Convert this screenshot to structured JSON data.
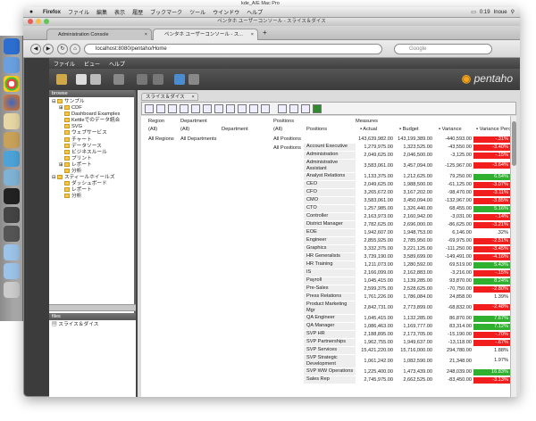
{
  "mac_menu": {
    "apple": "",
    "items": [
      "Firefox",
      "ファイル",
      "編集",
      "表示",
      "履歴",
      "ブックマーク",
      "ツール",
      "ウインドウ",
      "ヘルプ"
    ],
    "battery": "0:19",
    "user": "Inoue"
  },
  "screen_title": "kde_A/E Mac Pro",
  "window_title": "ペンタホ ユーザーコンソール - スライス＆ダイス",
  "tabs": [
    {
      "label": "Administration Console"
    },
    {
      "label": "ペンタホ ユーザーコンソール - ス..."
    }
  ],
  "new_tab": "+",
  "url": "localhost:8080/pentaho/Home",
  "search_placeholder": "Google",
  "app_menu": [
    "ファイル",
    "ビュー",
    "ヘルプ"
  ],
  "logo": {
    "mark": "◉",
    "text": "pentaho",
    "brand_color": "#f7a31a"
  },
  "browse": {
    "title": "browse",
    "tree": [
      {
        "label": "サンプル",
        "level": 0,
        "toggle": "⊟"
      },
      {
        "label": "CDF",
        "level": 1,
        "toggle": "⊞"
      },
      {
        "label": "Dashboard Examples",
        "level": 1,
        "toggle": ""
      },
      {
        "label": "Kettleでのデータ統合",
        "level": 1,
        "toggle": ""
      },
      {
        "label": "SVG",
        "level": 1,
        "toggle": ""
      },
      {
        "label": "ウェブサービス",
        "level": 1,
        "toggle": ""
      },
      {
        "label": "チャート",
        "level": 1,
        "toggle": ""
      },
      {
        "label": "データソース",
        "level": 1,
        "toggle": ""
      },
      {
        "label": "ビジネスルール",
        "level": 1,
        "toggle": ""
      },
      {
        "label": "プリント",
        "level": 1,
        "toggle": ""
      },
      {
        "label": "レポート",
        "level": 1,
        "toggle": "⊞"
      },
      {
        "label": "分析",
        "level": 1,
        "toggle": ""
      },
      {
        "label": "スティールホイールズ",
        "level": 0,
        "toggle": "⊟"
      },
      {
        "label": "ダッシュボード",
        "level": 1,
        "toggle": ""
      },
      {
        "label": "レポート",
        "level": 1,
        "toggle": ""
      },
      {
        "label": "分析",
        "level": 1,
        "toggle": ""
      }
    ]
  },
  "files": {
    "title": "files",
    "items": [
      "スライス＆ダイス"
    ]
  },
  "doc_tab": {
    "label": "スライス＆ダイス",
    "close": "×"
  },
  "pivot": {
    "h_region": "Region",
    "h_department": "Department",
    "h_positions": "Positions",
    "h_measures": "Measures",
    "all_region": "(All)",
    "all_department": "(All)",
    "department_col": "Department",
    "all_positions": "(All)",
    "positions_col": "Positions",
    "all_regions_label": "All Regions",
    "all_departments_label": "All Departments",
    "all_positions_label": "All Positions",
    "all_positions_label2": "All Positions",
    "cols": [
      "Actual",
      "Budget",
      "Variance",
      "Variance Percent"
    ],
    "rows": [
      {
        "name": "",
        "actual": "143,639,982.00",
        "budget": "143,199,389.00",
        "variance": "-440,593.00",
        "vp": "-.31%",
        "color": "red"
      },
      {
        "name": "Account Executive",
        "actual": "1,279,975.00",
        "budget": "1,323,525.00",
        "variance": "-43,550.00",
        "vp": "-3.40%",
        "color": "red"
      },
      {
        "name": "Administration",
        "actual": "2,049,625.00",
        "budget": "2,046,500.00",
        "variance": "-3,125.00",
        "vp": "-.15%",
        "color": "red"
      },
      {
        "name": "Administrative Assistant",
        "actual": "3,583,061.00",
        "budget": "3,457,094.00",
        "variance": "-125,967.00",
        "vp": "-3.64%",
        "color": "red"
      },
      {
        "name": "Analyst Relations",
        "actual": "1,133,375.00",
        "budget": "1,212,625.00",
        "variance": "79,250.00",
        "vp": "6.54%",
        "color": "green"
      },
      {
        "name": "CEO",
        "actual": "2,049,625.00",
        "budget": "1,988,500.00",
        "variance": "-61,125.00",
        "vp": "-3.07%",
        "color": "red"
      },
      {
        "name": "CFO",
        "actual": "3,265,672.00",
        "budget": "3,167,202.00",
        "variance": "-98,470.00",
        "vp": "-3.11%",
        "color": "red"
      },
      {
        "name": "CMO",
        "actual": "3,583,061.00",
        "budget": "3,450,094.00",
        "variance": "-132,967.00",
        "vp": "-3.85%",
        "color": "red"
      },
      {
        "name": "CTO",
        "actual": "1,257,985.00",
        "budget": "1,326,440.00",
        "variance": "68,455.00",
        "vp": "5.16%",
        "color": "green"
      },
      {
        "name": "Controller",
        "actual": "2,163,973.00",
        "budget": "2,160,942.00",
        "variance": "-3,031.00",
        "vp": "-.14%",
        "color": "red"
      },
      {
        "name": "District Manager",
        "actual": "2,782,625.00",
        "budget": "2,696,000.00",
        "variance": "-86,625.00",
        "vp": "-3.21%",
        "color": "red"
      },
      {
        "name": "EOE",
        "actual": "1,942,607.00",
        "budget": "1,948,753.00",
        "variance": "6,146.00",
        "vp": ".32%",
        "color": "none"
      },
      {
        "name": "Engineer",
        "actual": "2,855,925.00",
        "budget": "2,785,950.00",
        "variance": "-69,975.00",
        "vp": "-2.51%",
        "color": "red"
      },
      {
        "name": "Graphics",
        "actual": "3,332,375.00",
        "budget": "3,221,125.00",
        "variance": "-111,250.00",
        "vp": "-3.45%",
        "color": "red"
      },
      {
        "name": "HR Generalists",
        "actual": "3,739,190.00",
        "budget": "3,589,699.00",
        "variance": "-149,491.00",
        "vp": "-4.16%",
        "color": "red"
      },
      {
        "name": "HR Training",
        "actual": "1,211,073.00",
        "budget": "1,280,592.00",
        "variance": "69,519.00",
        "vp": "5.43%",
        "color": "green"
      },
      {
        "name": "IS",
        "actual": "2,166,099.00",
        "budget": "2,162,883.00",
        "variance": "-3,216.00",
        "vp": "-.15%",
        "color": "red"
      },
      {
        "name": "Payroll",
        "actual": "1,045,415.00",
        "budget": "1,139,285.00",
        "variance": "93,870.00",
        "vp": "8.24%",
        "color": "green"
      },
      {
        "name": "Pre-Sales",
        "actual": "2,599,375.00",
        "budget": "2,528,625.00",
        "variance": "-70,750.00",
        "vp": "-2.80%",
        "color": "red"
      },
      {
        "name": "Press Relations",
        "actual": "1,761,226.00",
        "budget": "1,786,084.00",
        "variance": "24,858.00",
        "vp": "1.39%",
        "color": "none"
      },
      {
        "name": "Product Marketing Mgr",
        "actual": "2,842,731.00",
        "budget": "2,773,899.00",
        "variance": "-68,832.00",
        "vp": "-2.48%",
        "color": "red"
      },
      {
        "name": "QA Engineer",
        "actual": "1,045,415.00",
        "budget": "1,132,285.00",
        "variance": "86,870.00",
        "vp": "7.67%",
        "color": "green"
      },
      {
        "name": "QA Manager",
        "actual": "1,086,463.00",
        "budget": "1,169,777.00",
        "variance": "83,314.00",
        "vp": "7.12%",
        "color": "green"
      },
      {
        "name": "SVP HR",
        "actual": "2,188,895.00",
        "budget": "2,173,705.00",
        "variance": "-15,190.00",
        "vp": "-.70%",
        "color": "red"
      },
      {
        "name": "SVP Partnerships",
        "actual": "1,962,755.00",
        "budget": "1,949,637.00",
        "variance": "-13,118.00",
        "vp": "-.67%",
        "color": "red"
      },
      {
        "name": "SVP Services",
        "actual": "15,421,220.00",
        "budget": "15,716,000.00",
        "variance": "294,780.00",
        "vp": "1.88%",
        "color": "none"
      },
      {
        "name": "SVP Strategic Development",
        "actual": "1,061,242.00",
        "budget": "1,082,590.00",
        "variance": "21,348.00",
        "vp": "1.97%",
        "color": "none"
      },
      {
        "name": "SVP WW Operations",
        "actual": "1,225,400.00",
        "budget": "1,473,439.00",
        "variance": "248,039.00",
        "vp": "16.83%",
        "color": "green"
      },
      {
        "name": "Sales Rep",
        "actual": "2,745,975.00",
        "budget": "2,662,525.00",
        "variance": "-83,450.00",
        "vp": "-3.13%",
        "color": "red"
      }
    ]
  },
  "colors": {
    "red": "#f21d1d",
    "green": "#2fb12f"
  }
}
